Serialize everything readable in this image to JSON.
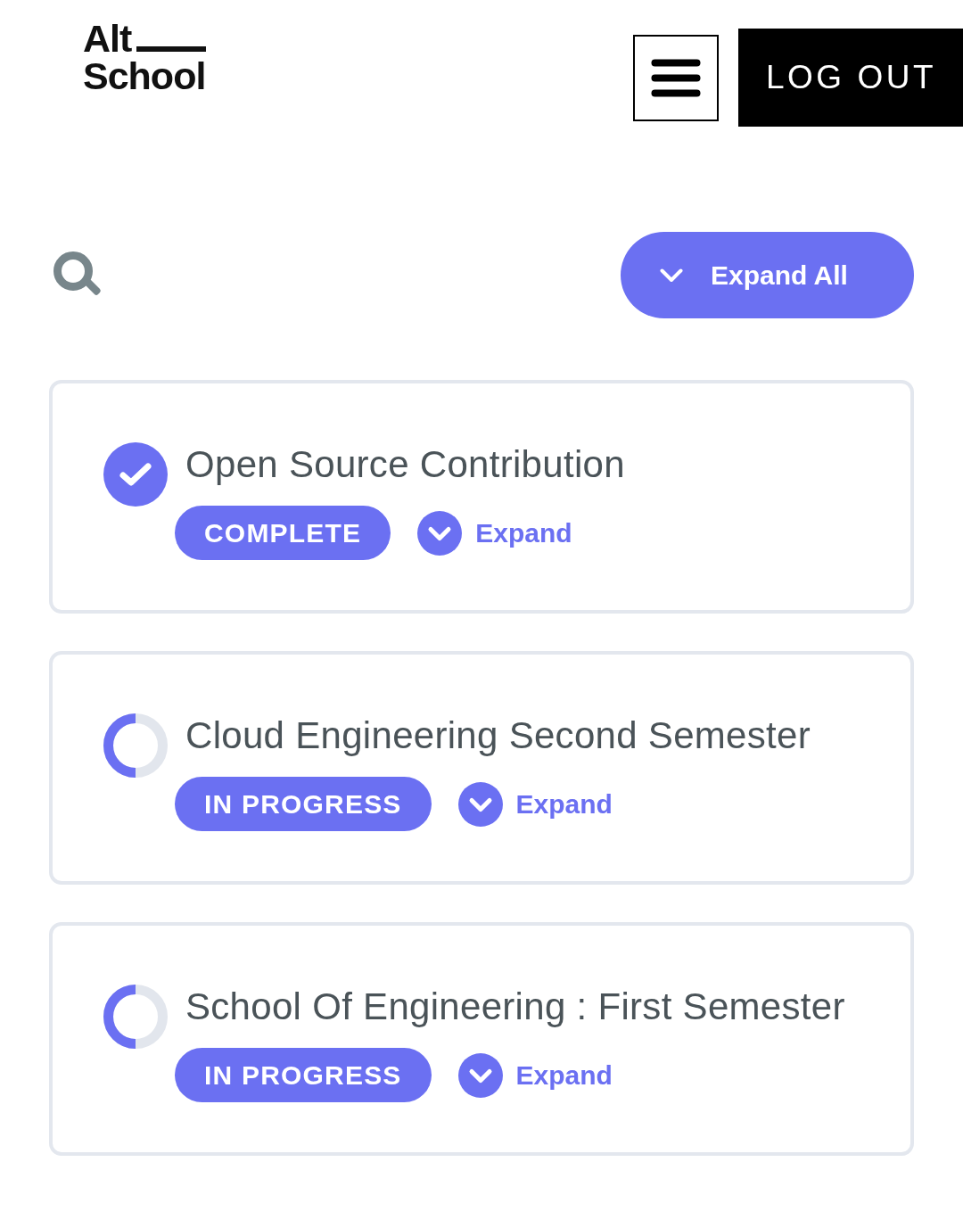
{
  "header": {
    "logo": {
      "line_1": "Alt",
      "line_2": "School"
    },
    "logout_button": "LOG OUT"
  },
  "toolbar": {
    "expand_all_button": "Expand All"
  },
  "courses": [
    {
      "title": "Open Source Contribution",
      "kind": "complete",
      "status": "COMPLETE",
      "expand_link": "Expand"
    },
    {
      "title": "Cloud Engineering Second Semester",
      "kind": "in_progress",
      "status": "IN PROGRESS",
      "expand_link": "Expand"
    },
    {
      "title": "School Of Engineering : First Semester",
      "kind": "in_progress",
      "status": "IN PROGRESS",
      "expand_link": "Expand"
    }
  ]
}
